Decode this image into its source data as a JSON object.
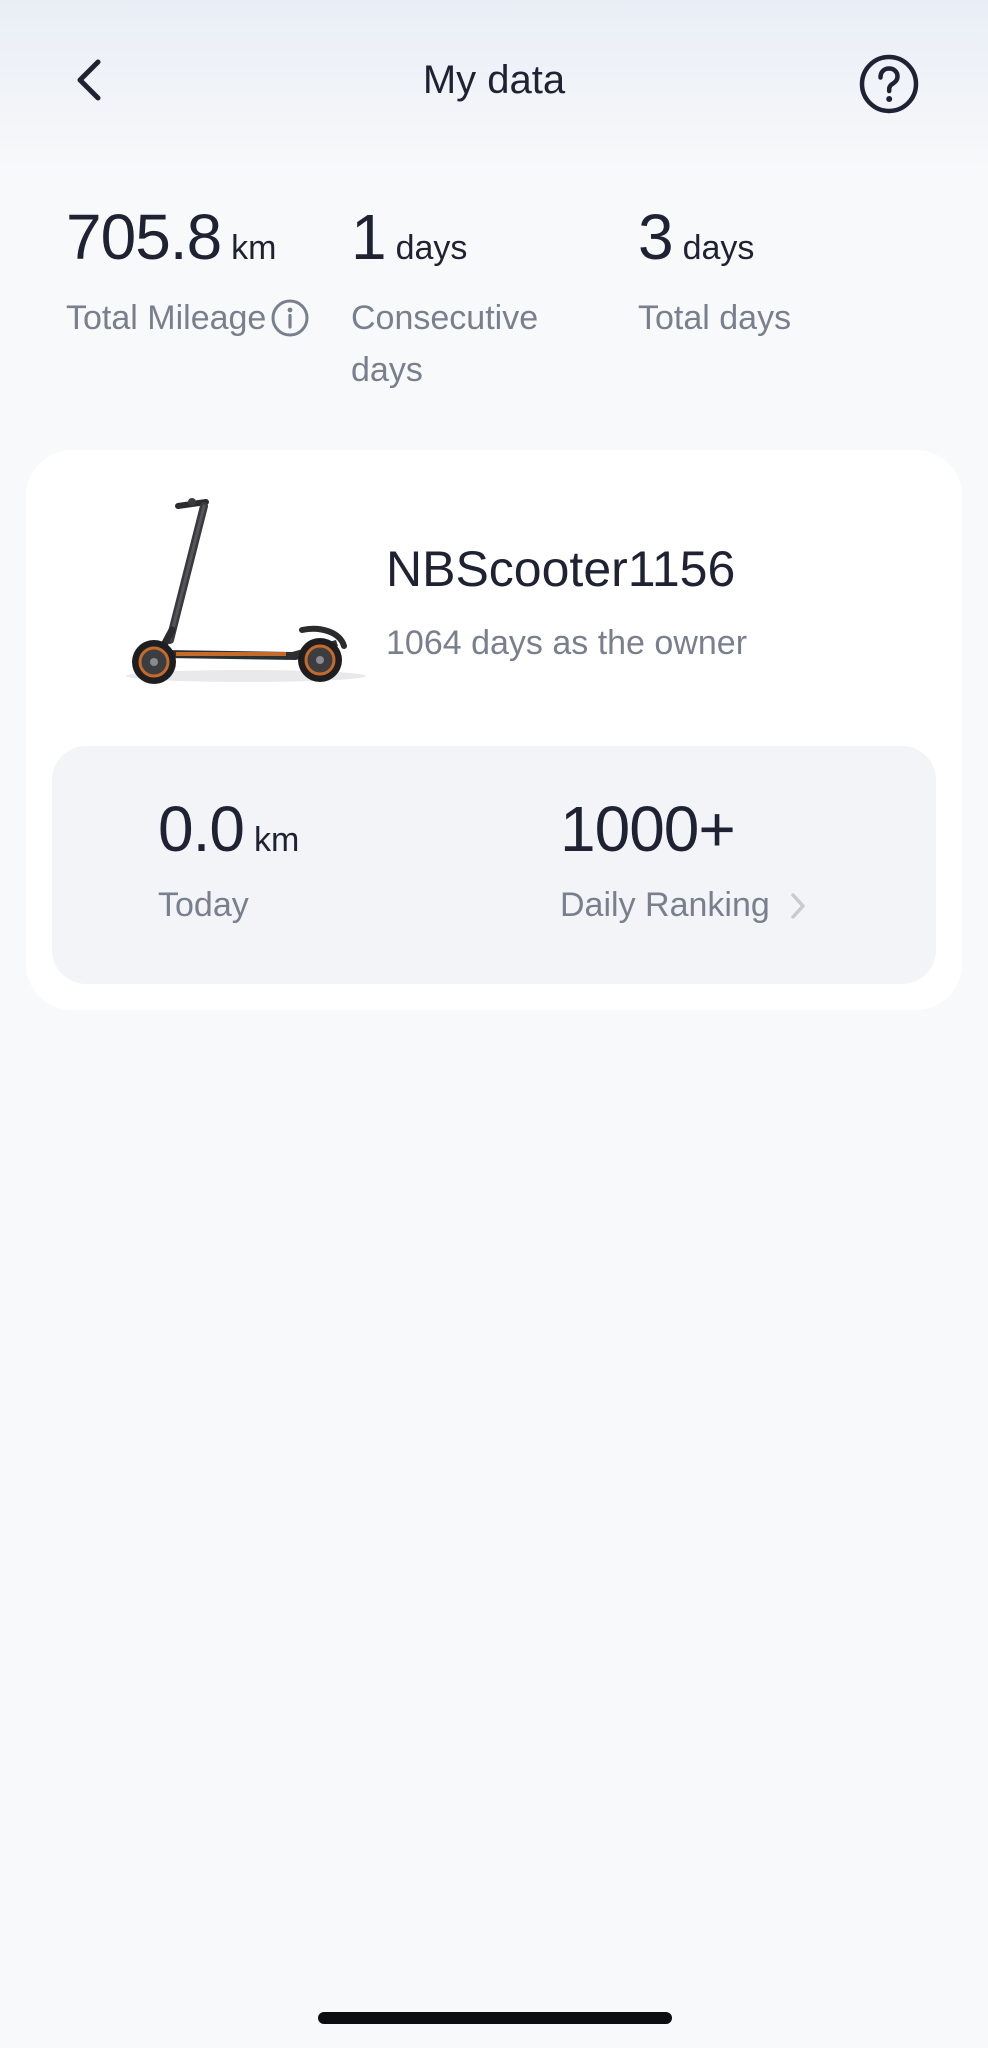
{
  "header": {
    "title": "My data",
    "back_icon": "chevron-left-icon",
    "help_icon": "question-circle-icon"
  },
  "stats": [
    {
      "value": "705.8",
      "unit": "km",
      "label": "Total Mileage",
      "has_info": true
    },
    {
      "value": "1",
      "unit": "days",
      "label": "Consecutive days"
    },
    {
      "value": "3",
      "unit": "days",
      "label": "Total days"
    }
  ],
  "device": {
    "name": "NBScooter1156",
    "ownership": "1064 days as the owner",
    "image_icon": "kick-scooter-icon"
  },
  "summary": {
    "today": {
      "value": "0.0",
      "unit": "km",
      "label": "Today"
    },
    "ranking": {
      "value": "1000+",
      "label": "Daily Ranking",
      "icon": "chevron-right-icon"
    }
  },
  "colors": {
    "primary_text": "#1f2233",
    "secondary_text": "#7a7f8e",
    "background": "#f8f9fb",
    "card": "#ffffff",
    "panel": "#f3f4f8"
  }
}
